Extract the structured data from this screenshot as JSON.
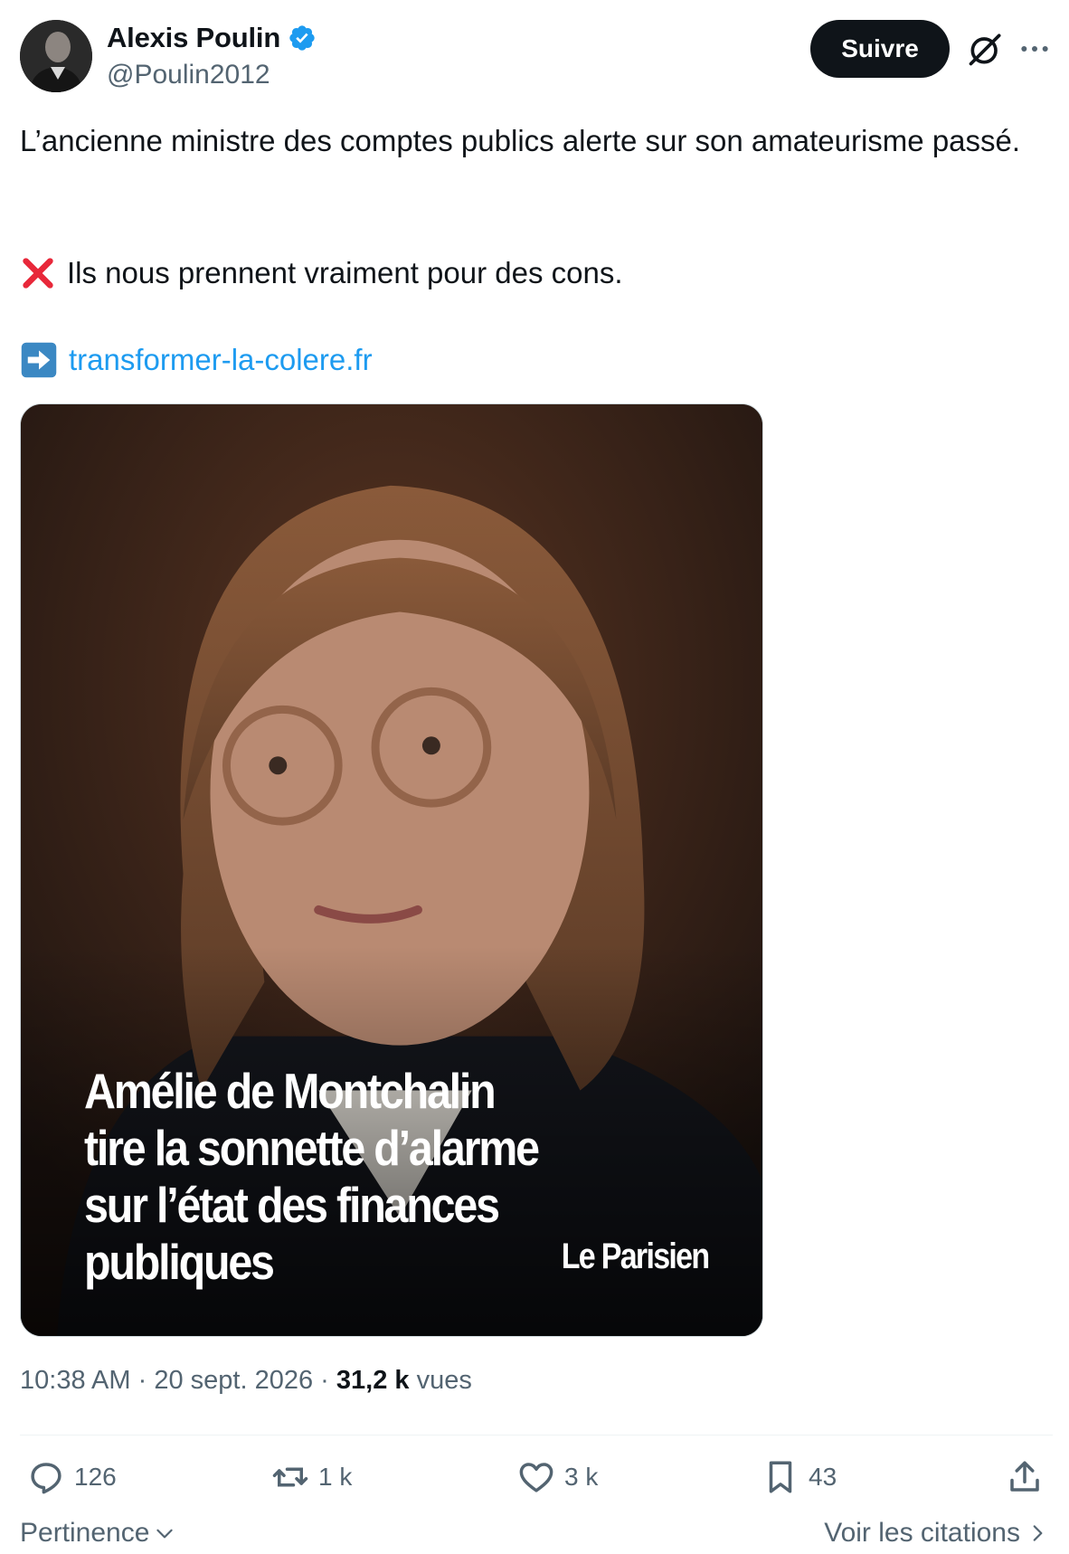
{
  "author": {
    "name": "Alexis Poulin",
    "handle": "@Poulin2012",
    "verified_color": "#1d9bf0"
  },
  "header": {
    "follow_label": "Suivre",
    "icons": [
      "grok-icon",
      "more-icon"
    ]
  },
  "tweet": {
    "line1": "L’ancienne ministre des comptes publics alerte sur son amateurisme passé.",
    "line2": "Ils nous prennent vraiment pour des cons.",
    "link": "transformer-la-colere.fr"
  },
  "media": {
    "headline": "Amélie de Montchalin tire la sonnette d’alarme sur l’état des finances publiques",
    "brand": "Le Parisien"
  },
  "meta": {
    "time": "10:38 AM",
    "date": "20 sept. 2026",
    "views_count": "31,2 k",
    "views_label": "vues",
    "separator": "·"
  },
  "actions": {
    "replies": "126",
    "reposts": "1 k",
    "likes": "3 k",
    "bookmarks": "43"
  },
  "footer": {
    "sort_label": "Pertinence",
    "quotes_label": "Voir les citations"
  },
  "colors": {
    "accent": "#1d9bf0",
    "text": "#0f1419",
    "muted": "#536471",
    "follow_bg": "#0f1419"
  }
}
